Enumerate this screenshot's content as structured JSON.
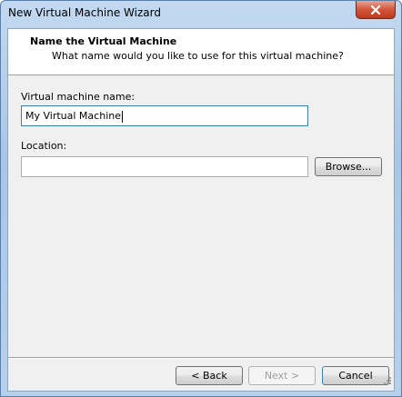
{
  "window": {
    "title": "New Virtual Machine Wizard"
  },
  "header": {
    "title": "Name the Virtual Machine",
    "subtitle": "What name would you like to use for this virtual machine?"
  },
  "form": {
    "vm_name_label": "Virtual machine name:",
    "vm_name_value": "My Virtual Machine",
    "location_label": "Location:",
    "location_value": "",
    "browse_label": "Browse..."
  },
  "footer": {
    "back_label": "< Back",
    "next_label": "Next >",
    "cancel_label": "Cancel"
  },
  "icons": {
    "close": "close-icon",
    "resize": "resize-grip-icon"
  },
  "colors": {
    "titlebar": "#a9c6e6",
    "close_button": "#c0391d",
    "header_background": "#ffffff",
    "dialog_background": "#f0f0f0",
    "focus_border": "#3c7fb1"
  }
}
